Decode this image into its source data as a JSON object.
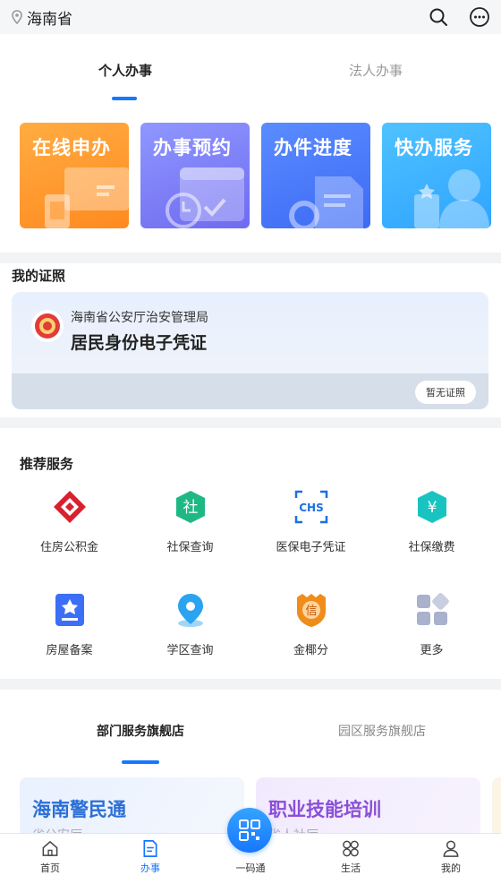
{
  "header": {
    "location": "海南省",
    "icons": [
      "location-pin-icon",
      "search-icon",
      "more-icon"
    ]
  },
  "main_tabs": [
    {
      "label": "个人办事",
      "active": true
    },
    {
      "label": "法人办事",
      "active": false
    }
  ],
  "quick_cards": [
    {
      "label": "在线申办",
      "color": "#ff9a2e"
    },
    {
      "label": "办事预约",
      "color": "#7a7ef6"
    },
    {
      "label": "办件进度",
      "color": "#4a78f8"
    },
    {
      "label": "快办服务",
      "color": "#3fb2ff"
    }
  ],
  "certificates": {
    "title": "我的证照",
    "org": "海南省公安厅治安管理局",
    "name": "居民身份电子凭证",
    "empty_button": "暂无证照"
  },
  "recommended": {
    "title": "推荐服务",
    "items": [
      {
        "label": "住房公积金",
        "icon": "housing-fund-icon"
      },
      {
        "label": "社保查询",
        "icon": "social-security-icon"
      },
      {
        "label": "医保电子凭证",
        "icon": "medical-insurance-icon"
      },
      {
        "label": "社保缴费",
        "icon": "payment-icon"
      },
      {
        "label": "房屋备案",
        "icon": "house-record-icon"
      },
      {
        "label": "学区查询",
        "icon": "school-district-icon"
      },
      {
        "label": "金椰分",
        "icon": "credit-score-icon"
      },
      {
        "label": "更多",
        "icon": "more-apps-icon"
      }
    ]
  },
  "flagship": {
    "tabs": [
      {
        "label": "部门服务旗舰店",
        "active": true
      },
      {
        "label": "园区服务旗舰店",
        "active": false
      }
    ],
    "cards": [
      {
        "title": "海南警民通",
        "subtitle": "省公安厅"
      },
      {
        "title": "职业技能培训",
        "subtitle": "省人社厅"
      }
    ]
  },
  "bottom_nav": [
    {
      "label": "首页",
      "icon": "home-icon",
      "active": false
    },
    {
      "label": "办事",
      "icon": "document-icon",
      "active": true
    },
    {
      "label": "一码通",
      "icon": "qr-code-icon",
      "active": false
    },
    {
      "label": "生活",
      "icon": "grid-icon",
      "active": false
    },
    {
      "label": "我的",
      "icon": "user-icon",
      "active": false
    }
  ]
}
